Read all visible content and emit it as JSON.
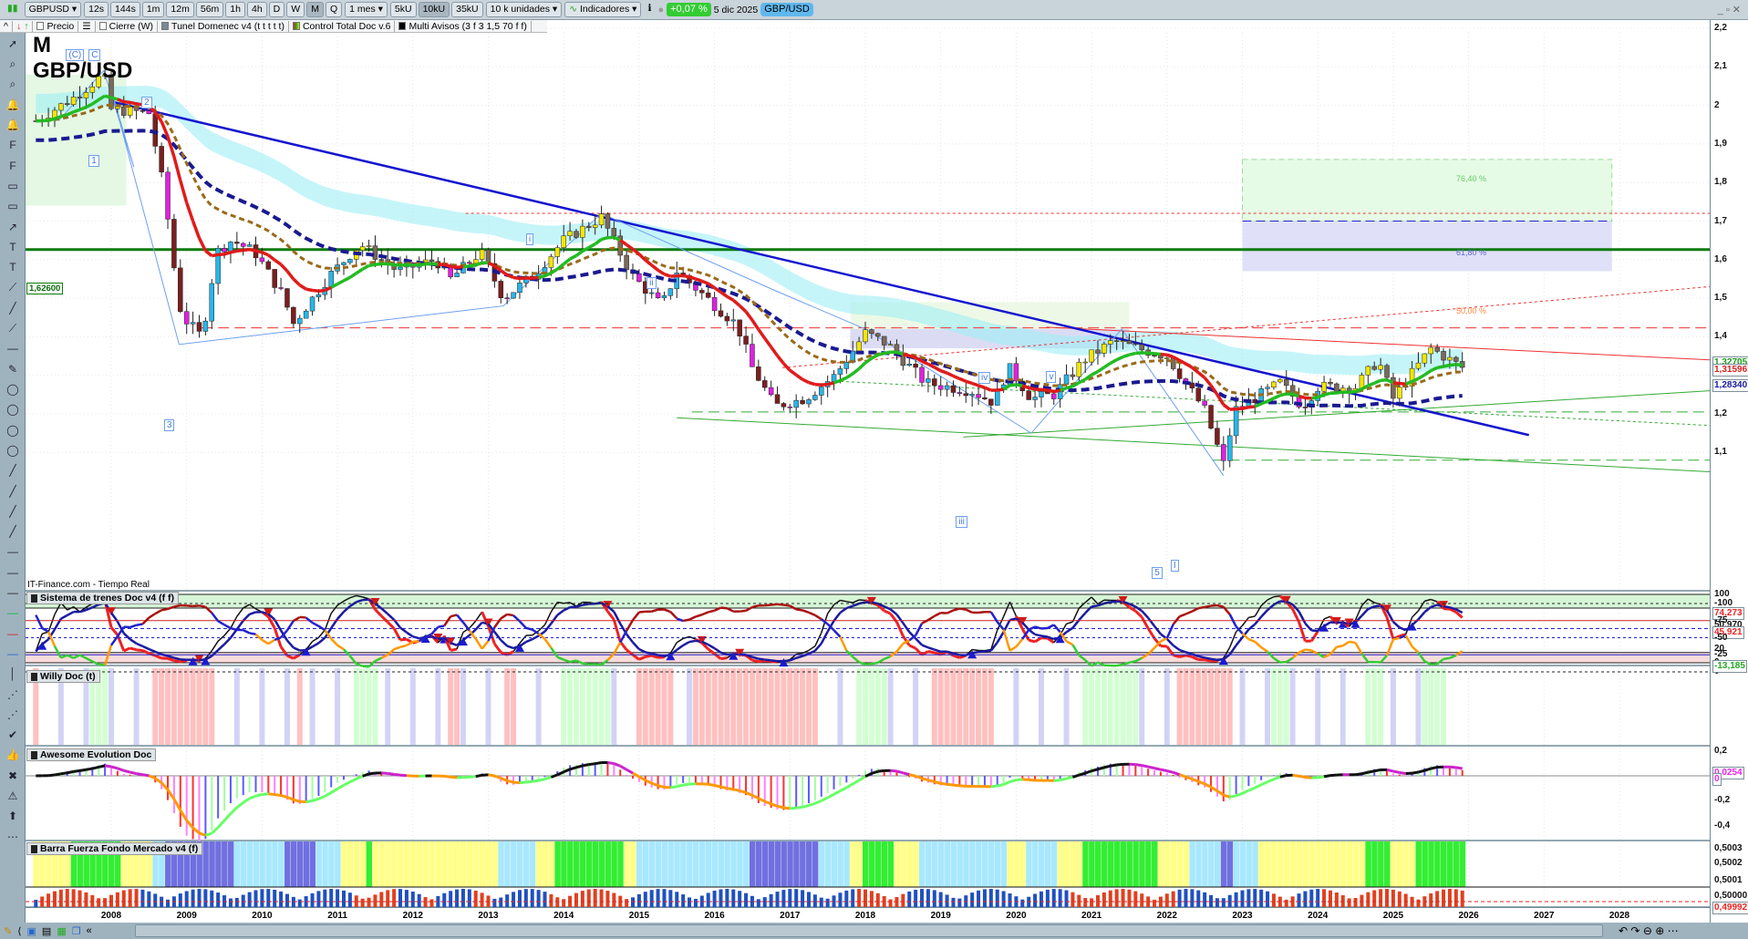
{
  "toolbar": {
    "symbol": "GBPUSD",
    "timeframes": [
      "12s",
      "144s",
      "1m",
      "12m",
      "56m",
      "1h",
      "4h",
      "D",
      "W",
      "M",
      "Q"
    ],
    "active_timeframe": "M",
    "period": "1 mes",
    "units_buttons": [
      "5kU",
      "10kU",
      "35kU"
    ],
    "active_units": "10kU",
    "units": "10 k unidades",
    "indicators_label": "Indicadores",
    "change": "+0,07 %",
    "date": "5 dic 2025",
    "pair": "GBP/USD"
  },
  "legend": {
    "price": "Precio",
    "close": "Cierre (W)",
    "tunel": "Tunel Domenec v4 (t t t t t)",
    "control": "Control Total Doc v.6",
    "alerts": "Multi Avisos (3 f 3 1,5 70 f f)"
  },
  "chart": {
    "period_letter": "M",
    "instrument": "GBP/USD",
    "source": "IT-Finance.com - Tiempo Real",
    "level_label": "1,62600",
    "fib_labels": {
      "f764": "76,40 %",
      "f618": "61,80 %",
      "f50": "50,00 %"
    },
    "wave_labels": [
      "(C)",
      "C",
      "1",
      "2",
      "3",
      "i",
      "ii",
      "iii",
      "iv",
      "v",
      "5",
      "I"
    ],
    "price_ticks": [
      "2,2",
      "2,1",
      "2",
      "1,9",
      "1,8",
      "1,7",
      "1,6",
      "1,5",
      "1,4",
      "1,2",
      "1,1"
    ],
    "price_tags": [
      {
        "value": "1,32705",
        "color": "#1a9a1a"
      },
      {
        "value": "1,31596",
        "color": "#d42020"
      },
      {
        "value": "1,28340",
        "color": "#1a1aa0"
      }
    ],
    "price_path": [
      [
        2007.0,
        1.96
      ],
      [
        2007.5,
        2.02
      ],
      [
        2007.9,
        2.08
      ],
      [
        2008.0,
        1.99
      ],
      [
        2008.5,
        1.98
      ],
      [
        2008.7,
        1.78
      ],
      [
        2008.9,
        1.48
      ],
      [
        2009.0,
        1.44
      ],
      [
        2009.2,
        1.4
      ],
      [
        2009.4,
        1.62
      ],
      [
        2009.6,
        1.65
      ],
      [
        2009.9,
        1.62
      ],
      [
        2010.3,
        1.5
      ],
      [
        2010.4,
        1.43
      ],
      [
        2010.9,
        1.56
      ],
      [
        2011.3,
        1.64
      ],
      [
        2011.8,
        1.57
      ],
      [
        2012.3,
        1.6
      ],
      [
        2012.5,
        1.55
      ],
      [
        2012.9,
        1.62
      ],
      [
        2013.2,
        1.5
      ],
      [
        2013.6,
        1.56
      ],
      [
        2014.0,
        1.65
      ],
      [
        2014.5,
        1.71
      ],
      [
        2014.9,
        1.56
      ],
      [
        2015.3,
        1.48
      ],
      [
        2015.5,
        1.57
      ],
      [
        2015.9,
        1.5
      ],
      [
        2016.3,
        1.43
      ],
      [
        2016.5,
        1.32
      ],
      [
        2016.8,
        1.22
      ],
      [
        2017.2,
        1.24
      ],
      [
        2017.6,
        1.3
      ],
      [
        2018.0,
        1.41
      ],
      [
        2018.3,
        1.38
      ],
      [
        2018.8,
        1.28
      ],
      [
        2019.4,
        1.26
      ],
      [
        2019.7,
        1.23
      ],
      [
        2019.9,
        1.32
      ],
      [
        2020.2,
        1.24
      ],
      [
        2020.5,
        1.25
      ],
      [
        2020.9,
        1.34
      ],
      [
        2021.3,
        1.39
      ],
      [
        2021.6,
        1.37
      ],
      [
        2022.0,
        1.35
      ],
      [
        2022.5,
        1.21
      ],
      [
        2022.75,
        1.07
      ],
      [
        2022.9,
        1.21
      ],
      [
        2023.5,
        1.28
      ],
      [
        2023.8,
        1.22
      ],
      [
        2024.0,
        1.27
      ],
      [
        2024.5,
        1.27
      ],
      [
        2024.8,
        1.34
      ],
      [
        2025.0,
        1.24
      ],
      [
        2025.5,
        1.37
      ],
      [
        2025.92,
        1.32
      ]
    ]
  },
  "panels": {
    "trenes": {
      "title": "Sistema de trenes Doc v4 (f f)",
      "ticks": [
        "100",
        "74,273",
        "50,970",
        "45,921",
        "20",
        "0"
      ]
    },
    "willy": {
      "title": "Willy Doc (t)",
      "ticks": [
        "0",
        "-13,185",
        "-25",
        "-50",
        "-75",
        "-100"
      ]
    },
    "awesome": {
      "title": "Awesome Evolution Doc",
      "ticks": [
        "0,2",
        "0,0254",
        "0",
        "-0,2",
        "-0,4"
      ]
    },
    "barra": {
      "title": "Barra Fuerza Fondo Mercado v4 (f)",
      "ticks": [
        "0,5003",
        "0,5002",
        "0,5001",
        "0,50000",
        "0,49992"
      ]
    }
  },
  "xaxis": {
    "years": [
      "2008",
      "2009",
      "2010",
      "2011",
      "2012",
      "2013",
      "2014",
      "2015",
      "2016",
      "2017",
      "2018",
      "2019",
      "2020",
      "2021",
      "2022",
      "2023",
      "2024",
      "2025",
      "2026",
      "2027",
      "2028"
    ]
  },
  "colors": {
    "up": "#f2e600",
    "down": "#7a1f1f",
    "bull": "#22bb22",
    "bear": "#e01a1a",
    "trend": "#1515d0",
    "level": "#0a7a0a"
  }
}
